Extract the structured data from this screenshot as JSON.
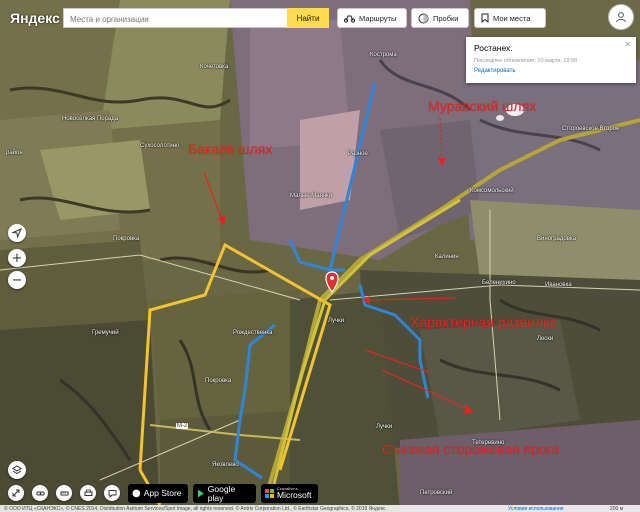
{
  "header": {
    "logo_text": "Яндекс",
    "search_placeholder": "Места и организации",
    "search_button": "Найти",
    "routes_button": "Маршруты",
    "traffic_button": "Пробки",
    "my_places_button": "Мои места"
  },
  "popup": {
    "title": "Ростанех.",
    "updated": "Последнее обновление: 10 марта, 19:58",
    "edit_link": "Редактировать"
  },
  "annotations": {
    "muravsky": "Муравский шлях",
    "bakaev": "Бакаев шлях",
    "razvilka": "Характерная развилка",
    "storozhevaya": "Съезжая сторожевая ярога"
  },
  "places": {
    "kochetovka": "Кочетовка",
    "kostromka": "Кострома",
    "novoselovka": "Новосёлкая Порада",
    "sukhosolotino": "Сухосолотино",
    "raion": "район",
    "pokrovka_top": "Покровка",
    "raznoe": "Разное",
    "malye_mayachki": "Малые Маячки",
    "komsomolsky": "Комсомольский",
    "stroroskoe": "Стороевское Второе",
    "vinogradovka": "Виноградовка",
    "kalinin": "Калинин",
    "belenikhino": "Беленихино",
    "ivanovka": "Ивановка",
    "leski": "Лески",
    "luchki_mid": "Лучки",
    "gremuchy": "Гремучий",
    "rozhdestvenka": "Рождественка",
    "pokrovka": "Покровка",
    "luchki": "Лучки",
    "teterevino": "Тетеревино",
    "yakovlevo": "Яковлево",
    "petrovsky": "Петровский",
    "road_label": "М-2"
  },
  "controls": {
    "zoom_in": "+",
    "zoom_out": "−"
  },
  "app_badges": {
    "appstore_small": "",
    "appstore_big": "App Store",
    "googleplay_small": "",
    "googleplay_big": "Google play",
    "microsoft_small": "Скачайте в",
    "microsoft_big": "Microsoft"
  },
  "footer": {
    "attribution": "© ООО ИТЦ «СКАНЭКС», © CNES 2014, Distribution Astrium Services/Spot Image, all rights reserved. © Antrix Corporation Ltd., © Earthstar Geographics, © 2015 Яндекс",
    "terms_link": "Условия использования",
    "scale": "200 м"
  },
  "colors": {
    "blue_route": "#2f86d8",
    "yellow_route": "#f4c430",
    "annotation": "#e8231f",
    "search_button": "#ffdb4d"
  }
}
